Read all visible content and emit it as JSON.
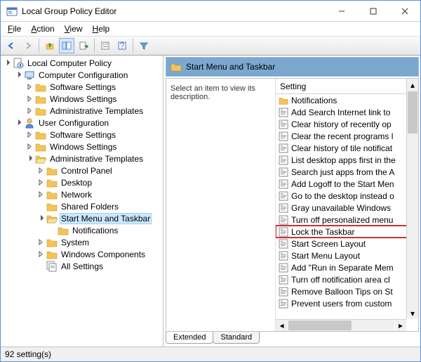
{
  "window": {
    "title": "Local Group Policy Editor"
  },
  "menubar": [
    "File",
    "Action",
    "View",
    "Help"
  ],
  "tree": {
    "root": "Local Computer Policy",
    "computer": {
      "label": "Computer Configuration",
      "children": [
        "Software Settings",
        "Windows Settings",
        "Administrative Templates"
      ]
    },
    "user": {
      "label": "User Configuration",
      "software": "Software Settings",
      "windows": "Windows Settings",
      "admin": {
        "label": "Administrative Templates",
        "children_before": [
          "Control Panel",
          "Desktop",
          "Network",
          "Shared Folders"
        ],
        "selected": {
          "label": "Start Menu and Taskbar",
          "child": "Notifications"
        },
        "children_after": [
          "System",
          "Windows Components",
          "All Settings"
        ]
      }
    }
  },
  "right": {
    "header": "Start Menu and Taskbar",
    "description": "Select an item to view its description.",
    "column": "Setting",
    "highlight_index": 11,
    "items": [
      "Notifications",
      "Add Search Internet link to",
      "Clear history of recently op",
      "Clear the recent programs l",
      "Clear history of tile notificat",
      "List desktop apps first in the",
      "Search just apps from the A",
      "Add Logoff to the Start Men",
      "Go to the desktop instead o",
      "Gray unavailable Windows",
      "Turn off personalized menu",
      "Lock the Taskbar",
      "Start Screen Layout",
      "Start Menu Layout",
      "Add \"Run in Separate Mem",
      "Turn off notification area cl",
      "Remove Balloon Tips on St",
      "Prevent users from custom"
    ]
  },
  "tabs": [
    "Extended",
    "Standard"
  ],
  "statusbar": "92 setting(s)"
}
